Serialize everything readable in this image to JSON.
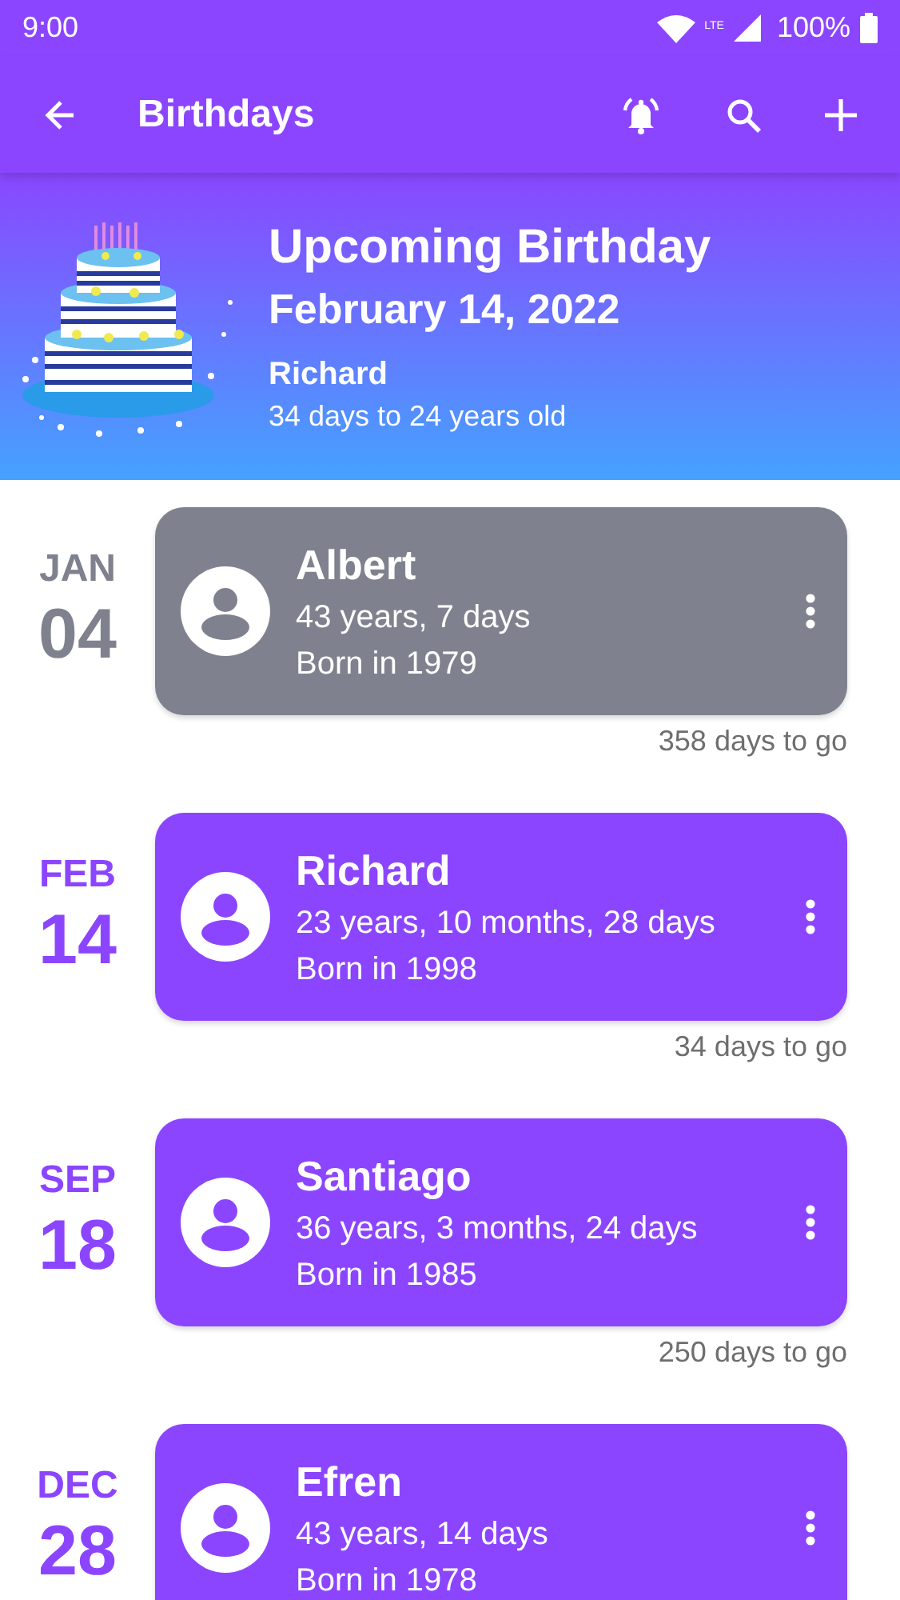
{
  "status_bar": {
    "time": "9:00",
    "network": "LTE",
    "battery": "100%"
  },
  "app_bar": {
    "title": "Birthdays"
  },
  "banner": {
    "heading": "Upcoming Birthday",
    "date": "February 14, 2022",
    "name": "Richard",
    "detail": "34 days to 24 years old"
  },
  "birthdays": [
    {
      "month": "JAN",
      "day": "04",
      "name": "Albert",
      "age": "43 years, 7 days",
      "born": "Born in 1979",
      "countdown": "358 days to go",
      "passed": true
    },
    {
      "month": "FEB",
      "day": "14",
      "name": "Richard",
      "age": "23 years, 10 months, 28 days",
      "born": "Born in 1998",
      "countdown": "34 days to go",
      "passed": false
    },
    {
      "month": "SEP",
      "day": "18",
      "name": "Santiago",
      "age": "36 years, 3 months, 24 days",
      "born": "Born in 1985",
      "countdown": "250 days to go",
      "passed": false
    },
    {
      "month": "DEC",
      "day": "28",
      "name": "Efren",
      "age": "43 years, 14 days",
      "born": "Born in 1978",
      "passed": false
    }
  ]
}
